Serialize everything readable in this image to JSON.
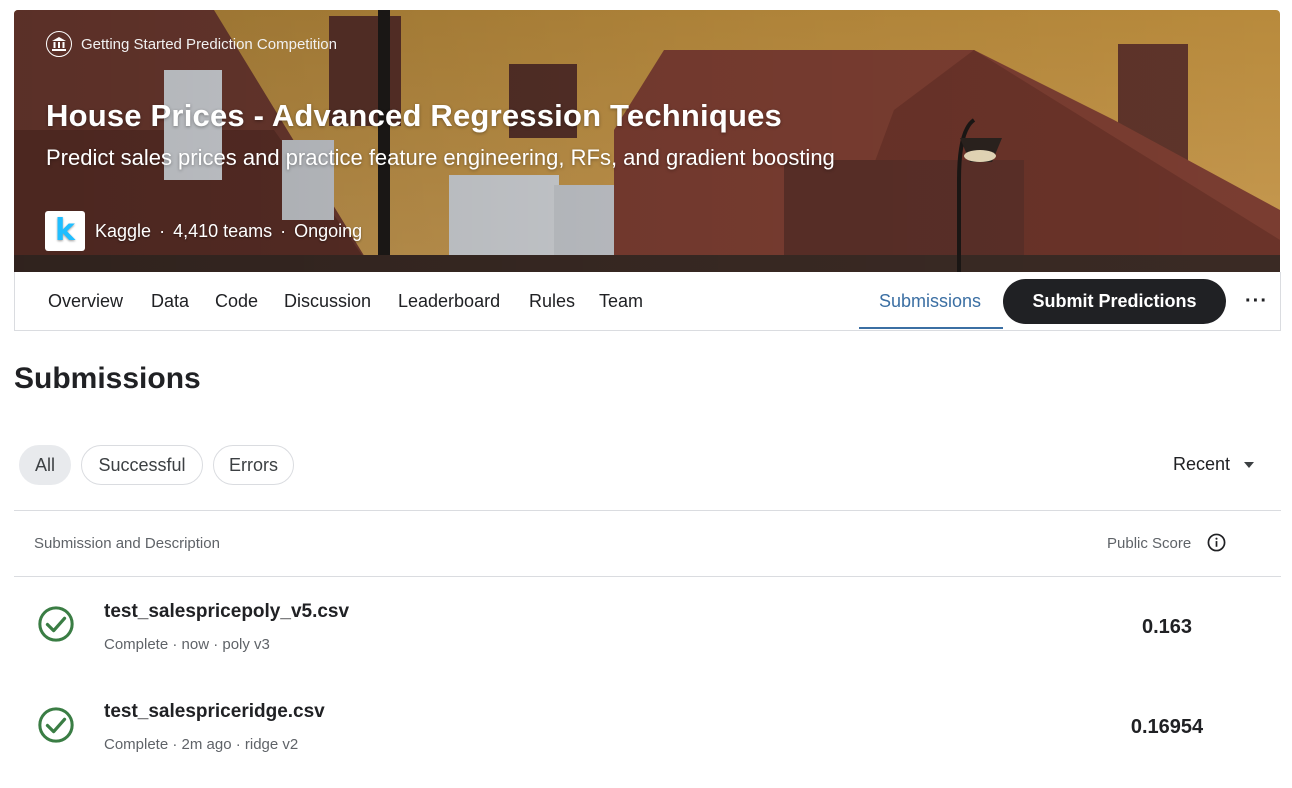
{
  "hero": {
    "category": "Getting Started Prediction Competition",
    "title": "House Prices - Advanced Regression Techniques",
    "subtitle": "Predict sales prices and practice feature engineering, RFs, and gradient boosting",
    "host_logo_letter": "k",
    "host": "Kaggle",
    "separator": "·",
    "teams": "4,410 teams",
    "status": "Ongoing"
  },
  "tabs": {
    "items": [
      "Overview",
      "Data",
      "Code",
      "Discussion",
      "Leaderboard",
      "Rules",
      "Team"
    ],
    "active": "Submissions",
    "submit_label": "Submit Predictions",
    "more_label": "···"
  },
  "page": {
    "title": "Submissions"
  },
  "filters": {
    "chips": [
      "All",
      "Successful",
      "Errors"
    ],
    "selected": "All",
    "sort_label": "Recent"
  },
  "table": {
    "col_submission": "Submission and Description",
    "col_score": "Public Score",
    "rows": [
      {
        "file": "test_salespricepoly_v5.csv",
        "meta": "Complete · now · poly v3",
        "score": "0.163"
      },
      {
        "file": "test_salespriceridge.csv",
        "meta": "Complete · 2m ago · ridge v2",
        "score": "0.16954"
      }
    ]
  },
  "colors": {
    "accent": "#3b6fa3",
    "success": "#3a7d44",
    "dark": "#202124",
    "kaggle_blue": "#20beff"
  }
}
